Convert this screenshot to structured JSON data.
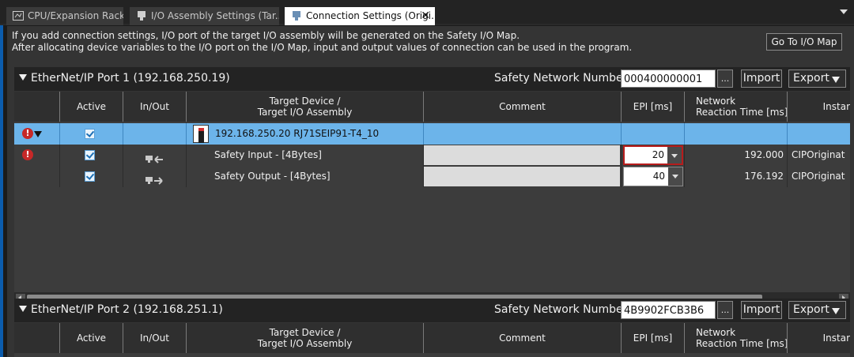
{
  "tabs": [
    {
      "label": "CPU/Expansion Racks",
      "icon": "rack-icon",
      "active": false
    },
    {
      "label": "I/O Assembly Settings (Tar...",
      "icon": "io-assembly-icon",
      "active": false
    },
    {
      "label": "Connection Settings (Origi...",
      "icon": "connection-icon",
      "active": true
    }
  ],
  "info": {
    "line1": "If you add connection settings, I/O port of the target I/O assembly will be generated on the Safety I/O Map.",
    "line2": "After allocating device variables to the I/O port on the I/O Map, input and output values of connection can be used in the program.",
    "goto_label": "Go To I/O Map"
  },
  "ports": [
    {
      "title": "EtherNet/IP Port 1 (192.168.250.19)",
      "snn_label": "Safety Network Number :",
      "snn_value": "000400000001",
      "dots": "...",
      "import_label": "Import",
      "export_label": "Export",
      "columns": [
        "Active",
        "In/Out",
        "Target Device /\nTarget I/O Assembly",
        "Comment",
        "EPI [ms]",
        "Network\nReaction Time [ms]",
        "Instar"
      ],
      "device_row": {
        "error": "!",
        "active": true,
        "device": "192.168.250.20 RJ71SEIP91-T4_10"
      },
      "rows": [
        {
          "error": "!",
          "active": true,
          "direction": "in",
          "assembly": "Safety Input - [4Bytes]",
          "epi": "20",
          "epi_error": true,
          "reaction": "192.000",
          "instance": "CIPOriginat"
        },
        {
          "error": "",
          "active": true,
          "direction": "out",
          "assembly": "Safety Output - [4Bytes]",
          "epi": "40",
          "epi_error": false,
          "reaction": "176.192",
          "instance": "CIPOriginat"
        }
      ]
    },
    {
      "title": "EtherNet/IP Port 2 (192.168.251.1)",
      "snn_label": "Safety Network Number :",
      "snn_value": "4B9902FCB3B6",
      "dots": "...",
      "import_label": "Import",
      "export_label": "Export",
      "columns": [
        "Active",
        "In/Out",
        "Target Device /\nTarget I/O Assembly",
        "Comment",
        "EPI [ms]",
        "Network\nReaction Time [ms]",
        "Instar"
      ]
    }
  ],
  "colors": {
    "selected_row": "#6cb4ea",
    "error": "#c62828",
    "accent": "#0b5cad"
  }
}
